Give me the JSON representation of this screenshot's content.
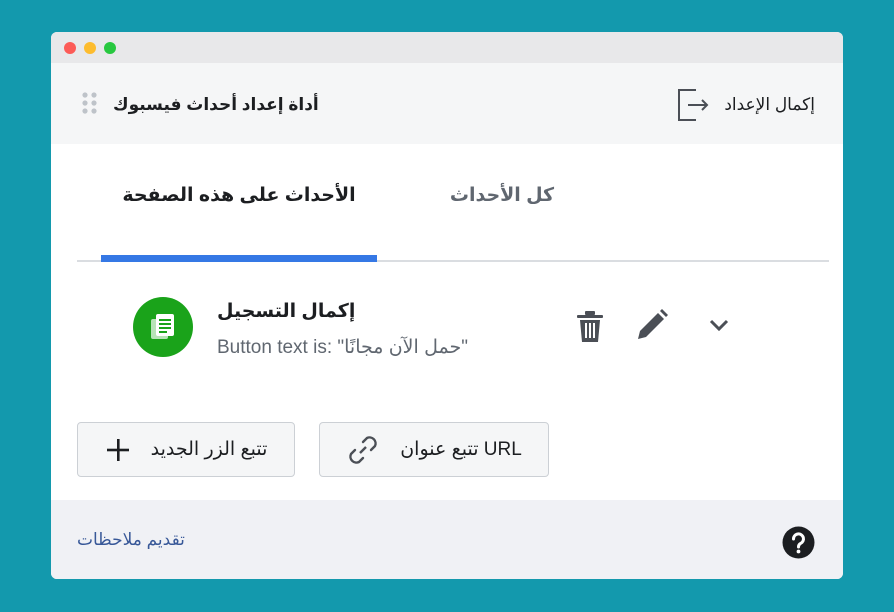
{
  "window": {
    "controls": [
      "close",
      "minimize",
      "maximize"
    ]
  },
  "header": {
    "finish_label": "إكمال الإعداد",
    "finish_icon": "exit-icon",
    "tool_title": "أداة إعداد أحداث فيسبوك",
    "drag_icon": "grip-icon"
  },
  "tabs": [
    {
      "label": "الأحداث على هذه الصفحة",
      "active": true
    },
    {
      "label": "كل الأحداث",
      "active": false
    }
  ],
  "event": {
    "title": "إكمال التسجيل",
    "subtitle": "Button text is: \"حمل الآن مجانًا\"",
    "icon": "registration-icon",
    "icon_color": "#1aa31a",
    "actions": [
      "trash-icon",
      "pencil-icon",
      "chevron-down-icon"
    ]
  },
  "buttons": {
    "track_new_button": "تتبع الزر الجديد",
    "track_url": "تتبع عنوان URL"
  },
  "footer": {
    "feedback_link": "تقديم ملاحظات",
    "help_icon": "help-icon"
  },
  "colors": {
    "background": "#1399ad",
    "accent": "#3578e5",
    "link": "#385898"
  }
}
